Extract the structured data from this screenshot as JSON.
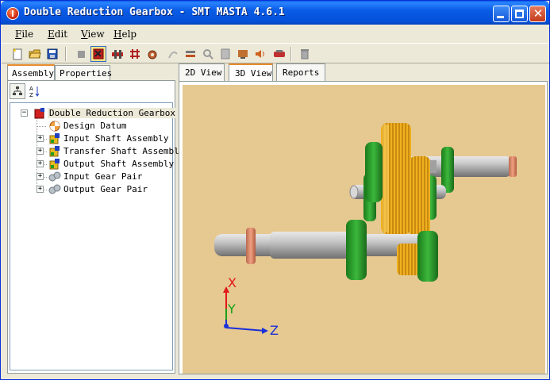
{
  "window": {
    "title": "Double Reduction Gearbox - SMT MASTA 4.6.1",
    "minimize_glyph": "",
    "maximize_glyph": "",
    "close_glyph": "✕"
  },
  "menu": [
    {
      "label": "File"
    },
    {
      "label": "Edit"
    },
    {
      "label": "View"
    },
    {
      "label": "Help"
    }
  ],
  "toolbar": {
    "icons": [
      "new-file-icon",
      "open-folder-icon",
      "save-icon",
      "stop-icon",
      "gearbox-icon",
      "assembly-icon",
      "shaft-icon",
      "gear-icon",
      "design-icon",
      "analysis-icon",
      "load-case-icon",
      "report-icon",
      "settings-icon",
      "sound-icon",
      "gear-set-icon",
      "delete-icon"
    ],
    "active_index": 4
  },
  "left_tabs": [
    {
      "label": "Assembly",
      "active": true
    },
    {
      "label": "Properties",
      "active": false
    }
  ],
  "tree": {
    "root": {
      "label": "Double Reduction Gearbox",
      "expander": "−"
    },
    "children": [
      {
        "label": "Design Datum",
        "icon": "design-datum-icon",
        "expander": ""
      },
      {
        "label": "Input Shaft Assembly",
        "icon": "assembly-icon",
        "expander": "+"
      },
      {
        "label": "Transfer Shaft Assembly",
        "icon": "assembly-icon",
        "expander": "+"
      },
      {
        "label": "Output Shaft Assembly",
        "icon": "assembly-icon",
        "expander": "+"
      },
      {
        "label": "Input Gear Pair",
        "icon": "gear-pair-icon",
        "expander": "+"
      },
      {
        "label": "Output Gear Pair",
        "icon": "gear-pair-icon",
        "expander": "+"
      }
    ]
  },
  "view_tabs": [
    {
      "label": "2D View",
      "active": false
    },
    {
      "label": "3D View",
      "active": true
    },
    {
      "label": "Reports",
      "active": false
    }
  ],
  "viewport": {
    "background": "#e6c891",
    "axes": {
      "x_label": "X",
      "y_label": "Y",
      "z_label": "Z",
      "x_color": "#e01818",
      "y_color": "#18a018",
      "z_color": "#1a30d8"
    },
    "colors": {
      "shaft": "#b4b4b4",
      "bearing": "#2e9e2e",
      "gear": "#f0a818",
      "collar": "#e08a6a"
    }
  }
}
